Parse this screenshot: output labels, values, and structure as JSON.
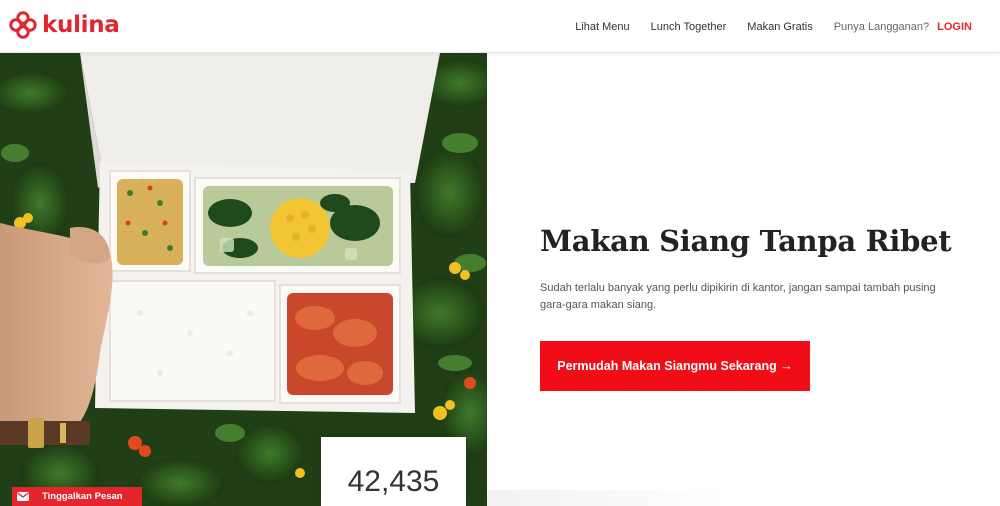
{
  "brand": {
    "name": "kulina",
    "color": "#e3262e",
    "logo_icon": "kulina-logo-icon"
  },
  "nav": {
    "items": [
      {
        "label": "Lihat Menu"
      },
      {
        "label": "Lunch Together"
      },
      {
        "label": "Makan Gratis"
      }
    ],
    "subscription_prompt": "Punya Langganan?",
    "login_label": "LOGIN"
  },
  "hero": {
    "title": "Makan Siang Tanpa Ribet",
    "subtitle": "Sudah terlalu banyak yang perlu dipikirin di kantor, jangan sampai tambah pusing gara-gara makan siang.",
    "cta_label": "Permudah Makan Siangmu Sekarang →",
    "cta_color": "#f00d17",
    "image_icon": "lunchbox-photo"
  },
  "counter": {
    "value": "42,435"
  },
  "message_tab": {
    "label": "Tinggalkan Pesan",
    "icon": "mail-icon"
  }
}
